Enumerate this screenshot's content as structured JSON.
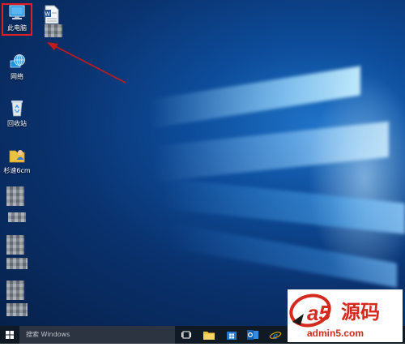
{
  "desktop": {
    "icons": {
      "this_pc": "此电脑",
      "network": "网络",
      "recycle_bin": "回收站",
      "user_folder": "杉速6cm"
    }
  },
  "taskbar": {
    "search_placeholder": "搜索 Windows"
  },
  "watermark": {
    "brand_mark": "a5",
    "brand_text": "源码",
    "site": "admin5.com"
  },
  "colors": {
    "selection_border": "#e02020",
    "arrow": "#c41a1a",
    "taskbar": "#101a24",
    "watermark_red": "#d42a1e"
  }
}
